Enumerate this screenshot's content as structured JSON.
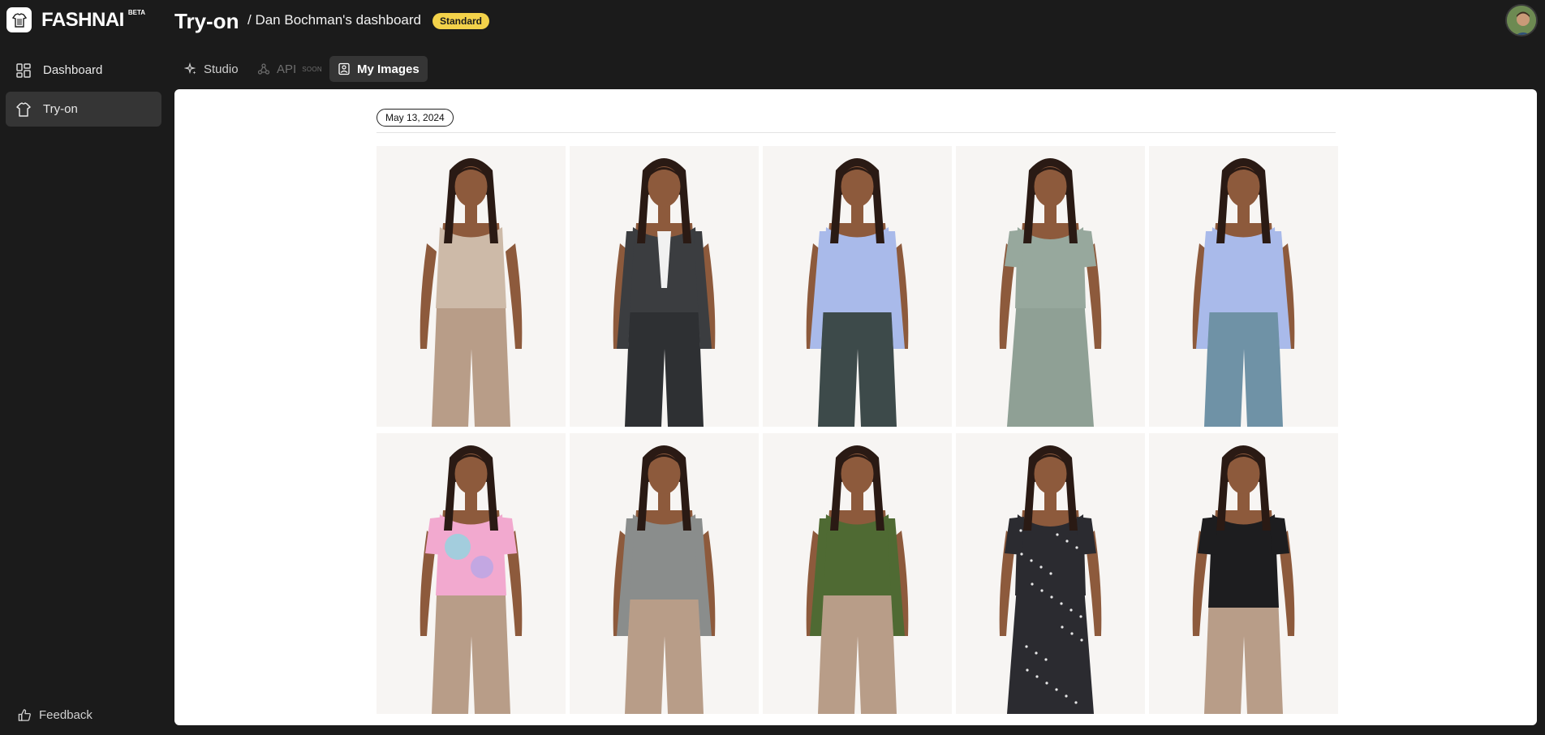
{
  "brand": {
    "name": "FASHNAI",
    "beta": "BETA"
  },
  "header": {
    "title": "Try-on",
    "breadcrumb": "/ Dan Bochman's dashboard",
    "plan_badge": "Standard"
  },
  "sidebar": {
    "items": [
      {
        "label": "Dashboard",
        "icon": "dashboard-grid-icon"
      },
      {
        "label": "Try-on",
        "icon": "shirt-icon",
        "active": true
      }
    ],
    "feedback": "Feedback"
  },
  "tabs": [
    {
      "label": "Studio",
      "icon": "sparkles-icon"
    },
    {
      "label": "API",
      "icon": "api-nodes-icon",
      "tag": "SOON",
      "disabled": true
    },
    {
      "label": "My Images",
      "icon": "image-gallery-icon",
      "active": true
    }
  ],
  "gallery": {
    "date": "May 13, 2024",
    "images": [
      {
        "top": "#cdbaa8",
        "bottom": "#b89d88",
        "style": "tank"
      },
      {
        "top": "#3b3d40",
        "bottom": "#2e3033",
        "style": "blazer"
      },
      {
        "top": "#a9baea",
        "bottom": "#3d4a4a",
        "style": "blouse"
      },
      {
        "top": "#97a89d",
        "bottom": "#8fa095",
        "style": "wrap-dress"
      },
      {
        "top": "#a9baea",
        "bottom": "#6f92a6",
        "style": "blouse"
      },
      {
        "top": "#f2a9cf",
        "bottom": "#b89d88",
        "style": "tie-dye-tee"
      },
      {
        "top": "#8a8d8c",
        "bottom": "#b89d88",
        "style": "sweater"
      },
      {
        "top": "#4f6a33",
        "bottom": "#b89d88",
        "style": "turtleneck"
      },
      {
        "top": "#2b2b30",
        "bottom": "#2b2b30",
        "style": "floral-dress"
      },
      {
        "top": "#1d1d1f",
        "bottom": "#b89d88",
        "style": "bustier"
      }
    ]
  }
}
